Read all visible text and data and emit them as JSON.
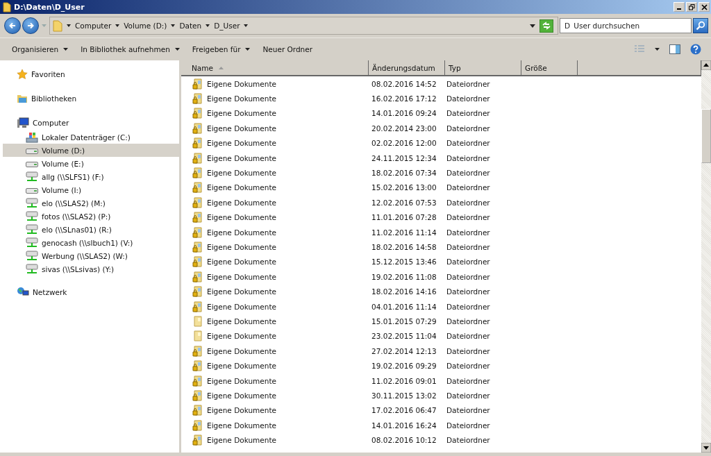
{
  "window": {
    "title": "D:\\Daten\\D_User"
  },
  "breadcrumb": [
    "Computer",
    "Volume (D:)",
    "Daten",
    "D_User"
  ],
  "search": {
    "placeholder": "D_User durchsuchen"
  },
  "toolbar": [
    "Organisieren",
    "In Bibliothek aufnehmen",
    "Freigeben für",
    "Neuer Ordner"
  ],
  "sidebar": {
    "groups": [
      {
        "label": "Favoriten",
        "kind": "star"
      },
      {
        "label": "Bibliotheken",
        "kind": "library"
      },
      {
        "label": "Computer",
        "kind": "computer",
        "children": [
          {
            "label": "Lokaler Datenträger (C:)",
            "kind": "system",
            "selected": false
          },
          {
            "label": "Volume (D:)",
            "kind": "drive",
            "selected": true
          },
          {
            "label": "Volume (E:)",
            "kind": "drive",
            "selected": false
          },
          {
            "label": "allg (\\\\SLFS1) (F:)",
            "kind": "network",
            "selected": false
          },
          {
            "label": "Volume (I:)",
            "kind": "drive",
            "selected": false
          },
          {
            "label": "elo (\\\\SLAS2) (M:)",
            "kind": "network",
            "selected": false
          },
          {
            "label": "fotos (\\\\SLAS2) (P:)",
            "kind": "network",
            "selected": false
          },
          {
            "label": "elo (\\\\SLnas01) (R:)",
            "kind": "network",
            "selected": false
          },
          {
            "label": "genocash (\\\\slbuch1) (V:)",
            "kind": "network",
            "selected": false
          },
          {
            "label": "Werbung (\\\\SLAS2) (W:)",
            "kind": "network",
            "selected": false
          },
          {
            "label": "sivas (\\\\SLsivas) (Y:)",
            "kind": "network",
            "selected": false
          }
        ]
      },
      {
        "label": "Netzwerk",
        "kind": "network-globe"
      }
    ]
  },
  "table": {
    "columns": [
      "Name",
      "Änderungsdatum",
      "Typ",
      "Größe"
    ],
    "rows": [
      {
        "name": "Eigene Dokumente",
        "date": "08.02.2016 14:52",
        "type": "Dateiordner",
        "kind": "locked"
      },
      {
        "name": "Eigene Dokumente",
        "date": "16.02.2016 17:12",
        "type": "Dateiordner",
        "kind": "locked"
      },
      {
        "name": "Eigene Dokumente",
        "date": "14.01.2016 09:24",
        "type": "Dateiordner",
        "kind": "locked"
      },
      {
        "name": "Eigene Dokumente",
        "date": "20.02.2014 23:00",
        "type": "Dateiordner",
        "kind": "locked"
      },
      {
        "name": "Eigene Dokumente",
        "date": "02.02.2016 12:00",
        "type": "Dateiordner",
        "kind": "locked"
      },
      {
        "name": "Eigene Dokumente",
        "date": "24.11.2015 12:34",
        "type": "Dateiordner",
        "kind": "locked"
      },
      {
        "name": "Eigene Dokumente",
        "date": "18.02.2016 07:34",
        "type": "Dateiordner",
        "kind": "locked"
      },
      {
        "name": "Eigene Dokumente",
        "date": "15.02.2016 13:00",
        "type": "Dateiordner",
        "kind": "locked"
      },
      {
        "name": "Eigene Dokumente",
        "date": "12.02.2016 07:53",
        "type": "Dateiordner",
        "kind": "locked"
      },
      {
        "name": "Eigene Dokumente",
        "date": "11.01.2016 07:28",
        "type": "Dateiordner",
        "kind": "locked"
      },
      {
        "name": "Eigene Dokumente",
        "date": "11.02.2016 11:14",
        "type": "Dateiordner",
        "kind": "locked"
      },
      {
        "name": "Eigene Dokumente",
        "date": "18.02.2016 14:58",
        "type": "Dateiordner",
        "kind": "locked"
      },
      {
        "name": "Eigene Dokumente",
        "date": "15.12.2015 13:46",
        "type": "Dateiordner",
        "kind": "locked"
      },
      {
        "name": "Eigene Dokumente",
        "date": "19.02.2016 11:08",
        "type": "Dateiordner",
        "kind": "locked"
      },
      {
        "name": "Eigene Dokumente",
        "date": "18.02.2016 14:16",
        "type": "Dateiordner",
        "kind": "locked"
      },
      {
        "name": "Eigene Dokumente",
        "date": "04.01.2016 11:14",
        "type": "Dateiordner",
        "kind": "locked"
      },
      {
        "name": "Eigene Dokumente",
        "date": "15.01.2015 07:29",
        "type": "Dateiordner",
        "kind": "plain"
      },
      {
        "name": "Eigene Dokumente",
        "date": "23.02.2015 11:04",
        "type": "Dateiordner",
        "kind": "plain"
      },
      {
        "name": "Eigene Dokumente",
        "date": "27.02.2014 12:13",
        "type": "Dateiordner",
        "kind": "locked"
      },
      {
        "name": "Eigene Dokumente",
        "date": "19.02.2016 09:29",
        "type": "Dateiordner",
        "kind": "locked"
      },
      {
        "name": "Eigene Dokumente",
        "date": "11.02.2016 09:01",
        "type": "Dateiordner",
        "kind": "locked"
      },
      {
        "name": "Eigene Dokumente",
        "date": "30.11.2015 13:02",
        "type": "Dateiordner",
        "kind": "locked"
      },
      {
        "name": "Eigene Dokumente",
        "date": "17.02.2016 06:47",
        "type": "Dateiordner",
        "kind": "locked"
      },
      {
        "name": "Eigene Dokumente",
        "date": "14.01.2016 16:24",
        "type": "Dateiordner",
        "kind": "locked"
      },
      {
        "name": "Eigene Dokumente",
        "date": "08.02.2016 10:12",
        "type": "Dateiordner",
        "kind": "locked"
      }
    ]
  }
}
